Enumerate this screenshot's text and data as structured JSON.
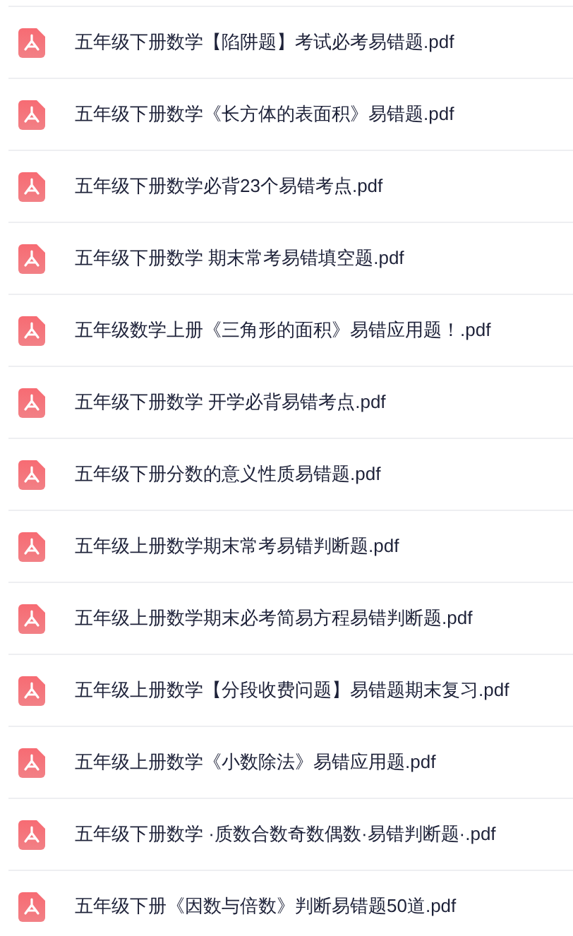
{
  "files": [
    {
      "name": "五年级下册数学【陷阱题】考试必考易错题.pdf"
    },
    {
      "name": "五年级下册数学《长方体的表面积》易错题.pdf"
    },
    {
      "name": "五年级下册数学必背23个易错考点.pdf"
    },
    {
      "name": "五年级下册数学 期末常考易错填空题.pdf"
    },
    {
      "name": "五年级数学上册《三角形的面积》易错应用题！.pdf"
    },
    {
      "name": "五年级下册数学 开学必背易错考点.pdf"
    },
    {
      "name": "五年级下册分数的意义性质易错题.pdf"
    },
    {
      "name": "五年级上册数学期末常考易错判断题.pdf"
    },
    {
      "name": "五年级上册数学期末必考简易方程易错判断题.pdf"
    },
    {
      "name": "五年级上册数学【分段收费问题】易错题期末复习.pdf"
    },
    {
      "name": "五年级上册数学《小数除法》易错应用题.pdf"
    },
    {
      "name": "五年级下册数学 ·质数合数奇数偶数·易错判断题·.pdf"
    },
    {
      "name": "五年级下册《因数与倍数》判断易错题50道.pdf"
    }
  ]
}
